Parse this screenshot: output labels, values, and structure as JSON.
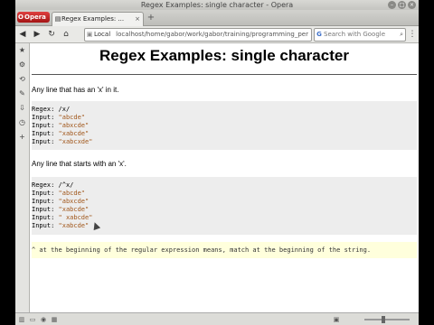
{
  "window": {
    "title": "Regex Examples: single character - Opera"
  },
  "tabbar": {
    "opera_label": "Opera",
    "tab_title": "Regex Examples: ..."
  },
  "toolbar": {
    "address_location_label": "Local",
    "address_url": "localhost/home/gabor/work/gabor/training/programming_per",
    "search_placeholder": "Search with Google"
  },
  "page": {
    "title": "Regex Examples: single character",
    "sections": [
      {
        "description": "Any line that has an 'x' in it.",
        "code": [
          {
            "label": "Regex: ",
            "value": "/x/",
            "is_string": false
          },
          {
            "label": "Input: ",
            "value": "\"abcde\"",
            "is_string": true
          },
          {
            "label": "Input: ",
            "value": "\"abxcde\"",
            "is_string": true
          },
          {
            "label": "Input: ",
            "value": "\"xabcde\"",
            "is_string": true
          },
          {
            "label": "Input: ",
            "value": "\"xabcxde\"",
            "is_string": true
          }
        ]
      },
      {
        "description": "Any line that starts with an 'x'.",
        "code": [
          {
            "label": "Regex: ",
            "value": "/^x/",
            "is_string": false
          },
          {
            "label": "Input: ",
            "value": "\"abcde\"",
            "is_string": true
          },
          {
            "label": "Input: ",
            "value": "\"abxcde\"",
            "is_string": true
          },
          {
            "label": "Input: ",
            "value": "\"xabcde\"",
            "is_string": true
          },
          {
            "label": "Input: ",
            "value": "\" xabcde\"",
            "is_string": true
          },
          {
            "label": "Input: ",
            "value": "\"xabcde\"",
            "is_string": true
          }
        ]
      }
    ],
    "note": "^ at the beginning of the regular expression means, match at the beginning of the string."
  }
}
